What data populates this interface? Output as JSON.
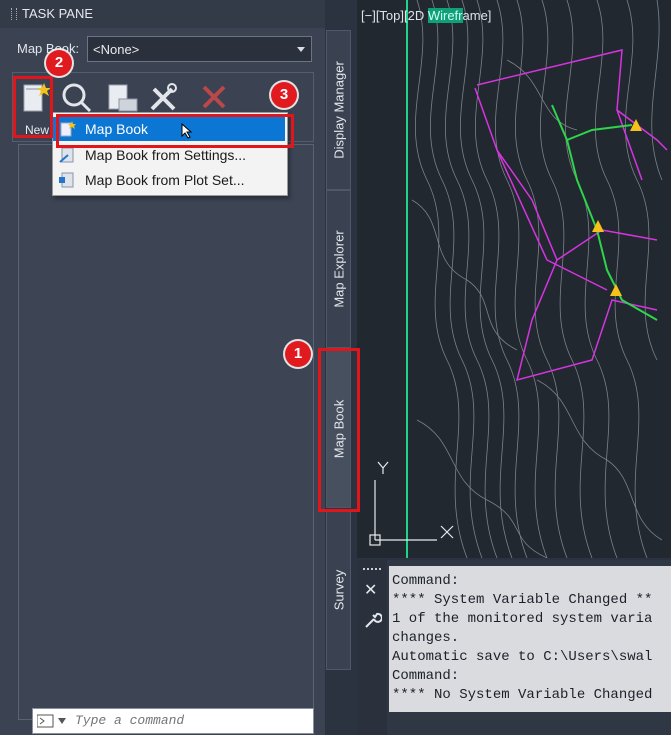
{
  "task_pane": {
    "title": "TASK PANE",
    "map_book_label": "Map Book:",
    "map_book_value": "<None>",
    "new_label": "New"
  },
  "side_tabs": [
    "Display Manager",
    "Map Explorer",
    "Map Book",
    "Survey"
  ],
  "viewport": {
    "label_prefix": "[−][Top][2D ",
    "label_wf": "Wirefr",
    "label_suffix": "ame]"
  },
  "dropdown": {
    "items": [
      "Map Book",
      "Map Book from Settings...",
      "Map Book from Plot Set..."
    ]
  },
  "callouts": [
    "1",
    "2",
    "3"
  ],
  "command": {
    "history": [
      "Command:",
      "**** System Variable Changed **",
      "1 of the monitored system varia",
      "changes.",
      "Automatic save to C:\\Users\\swal",
      "Command:",
      "**** No System Variable Changed"
    ],
    "placeholder": "Type a command"
  },
  "colors": {
    "highlight": "#e2151a",
    "selection": "#0c76d4",
    "pane_bg": "#3b4353"
  }
}
